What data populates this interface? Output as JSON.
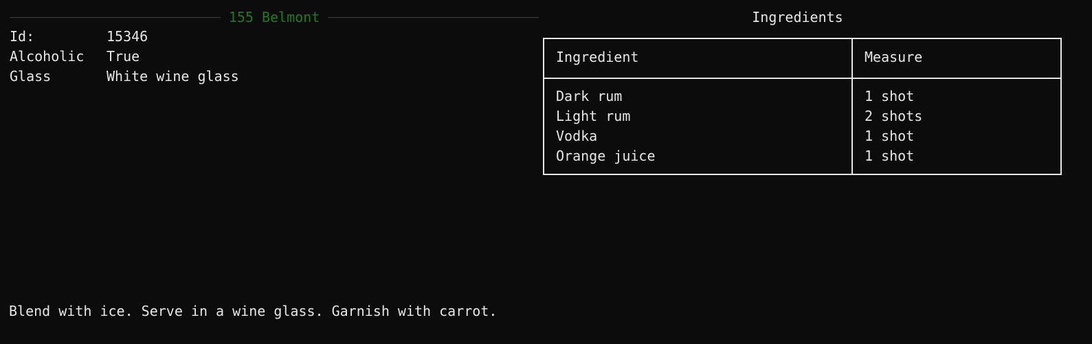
{
  "drink": {
    "title": "155 Belmont",
    "details": [
      {
        "label": "Id:",
        "value": "15346"
      },
      {
        "label": "Alcoholic",
        "value": "True"
      },
      {
        "label": "Glass",
        "value": "White wine glass"
      }
    ],
    "instructions": "Blend with ice. Serve in a wine glass. Garnish with carrot."
  },
  "ingredients": {
    "header": "Ingredients",
    "columns": [
      "Ingredient",
      "Measure"
    ],
    "rows": [
      {
        "ingredient": "Dark rum",
        "measure": "1 shot"
      },
      {
        "ingredient": "Light rum",
        "measure": "2 shots"
      },
      {
        "ingredient": "Vodka",
        "measure": "1 shot"
      },
      {
        "ingredient": "Orange juice",
        "measure": "1 shot"
      }
    ]
  },
  "colors": {
    "background": "#0c0c0c",
    "text": "#e6e6e6",
    "title": "#1f7a1f",
    "rule": "#8a1e1e",
    "table_border": "#e6e6e6"
  }
}
